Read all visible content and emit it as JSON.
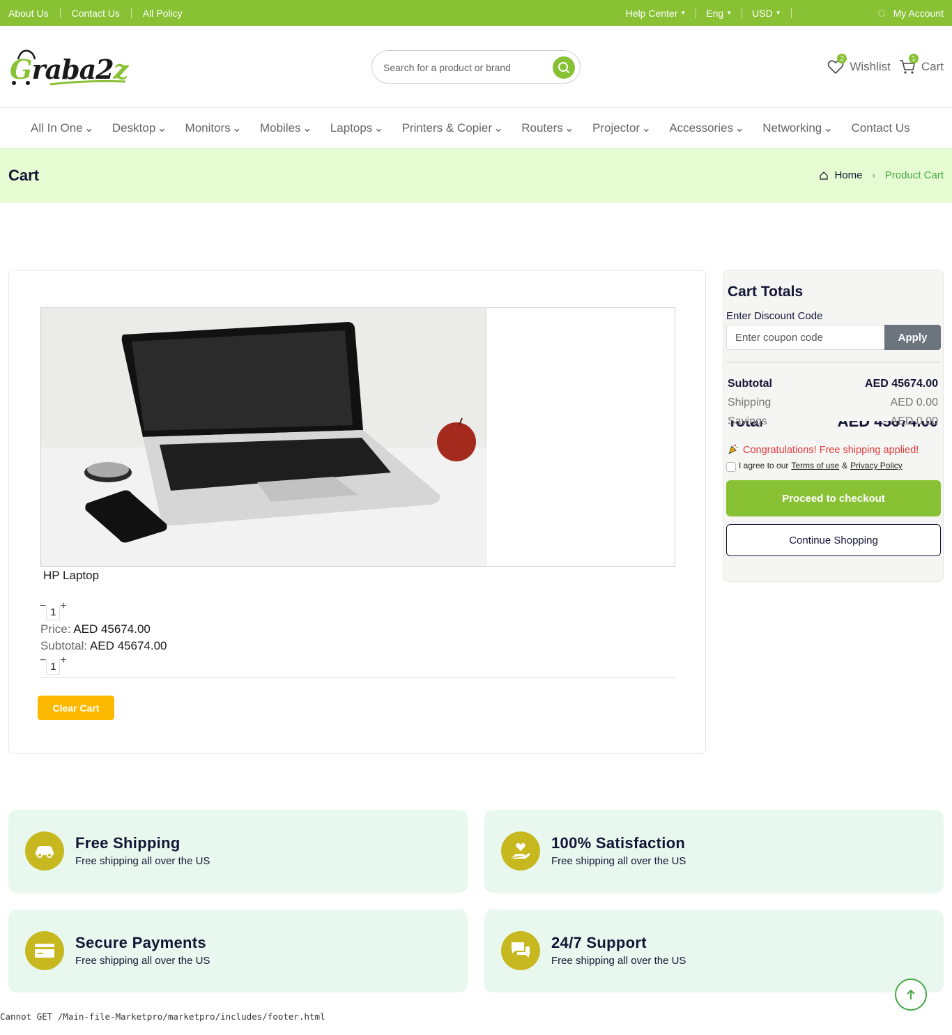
{
  "topbar": {
    "links": [
      "About Us",
      "Contact Us",
      "All Policy"
    ],
    "help": "Help Center",
    "lang": "Eng",
    "currency": "USD",
    "account": "My Account"
  },
  "header": {
    "logo": "Graba2z",
    "search_placeholder": "Search for a product or brand",
    "wishlist_label": "Wishlist",
    "wishlist_count": "2",
    "cart_label": "Cart",
    "cart_count": "1"
  },
  "nav": [
    "All In One",
    "Desktop",
    "Monitors",
    "Mobiles",
    "Laptops",
    "Printers & Copier",
    "Routers",
    "Projector",
    "Accessories",
    "Networking",
    "Contact Us"
  ],
  "page": {
    "title": "Cart",
    "breadcrumb_home": "Home",
    "breadcrumb_current": "Product Cart"
  },
  "cart": {
    "product_name": "HP Laptop",
    "qty": "1",
    "qty2": "1",
    "price_label": "Price:",
    "price": "AED 45674.00",
    "subtotal_label": "Subtotal:",
    "subtotal": "AED 45674.00",
    "clear_label": "Clear Cart"
  },
  "totals": {
    "title": "Cart Totals",
    "discount_label": "Enter Discount Code",
    "coupon_placeholder": "Enter coupon code",
    "apply": "Apply",
    "subtotal_label": "Subtotal",
    "subtotal": "AED 45674.00",
    "shipping_label": "Shipping",
    "shipping": "AED 0.00",
    "savings_label": "Savings",
    "savings": "- AED 0.00",
    "total_label": "Total",
    "total": "AED 45674.00",
    "congrats": "Congratulations! Free shipping applied!",
    "agree_prefix": "I agree to our",
    "terms": "Terms of use",
    "amp": "&",
    "privacy": "Privacy Policy",
    "checkout": "Proceed to checkout",
    "continue": "Continue Shopping"
  },
  "features": [
    {
      "title": "Free Shipping",
      "text": "Free shipping all over the US",
      "icon": "car-icon"
    },
    {
      "title": "100% Satisfaction",
      "text": "Free shipping all over the US",
      "icon": "hand-heart-icon"
    },
    {
      "title": "Secure Payments",
      "text": "Free shipping all over the US",
      "icon": "credit-card-icon"
    },
    {
      "title": "24/7 Support",
      "text": "Free shipping all over the US",
      "icon": "chat-icon"
    }
  ],
  "error_text": "Cannot GET /Main-file-Marketpro/marketpro/includes/footer.html",
  "colors": {
    "brand": "#88c134",
    "band": "#e5fbd1",
    "feature_bg": "#e8f8ee",
    "feature_icon": "#c8b820",
    "clear_button": "#fcb900"
  }
}
